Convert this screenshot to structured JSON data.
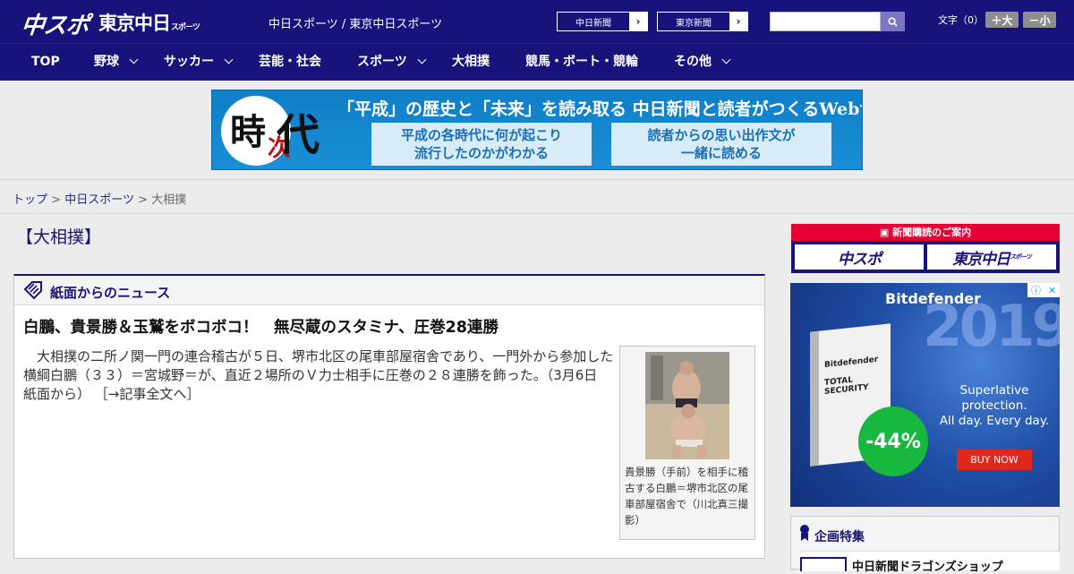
{
  "header": {
    "logo_chuspo": "中スポ",
    "logo_tokyo": "東京中日",
    "logo_tokyo_small": "スポーツ",
    "site_names": "中日スポーツ / 東京中日スポーツ",
    "paper_buttons": [
      {
        "label": "中日新聞",
        "arrow": "›"
      },
      {
        "label": "東京新聞",
        "arrow": "›"
      }
    ],
    "search": {
      "placeholder": "",
      "value": ""
    },
    "font_size": {
      "label": "文字（0）",
      "larger": "＋大",
      "smaller": "－小"
    }
  },
  "nav": [
    {
      "label": "TOP",
      "dropdown": false
    },
    {
      "label": "野球",
      "dropdown": true
    },
    {
      "label": "サッカー",
      "dropdown": true
    },
    {
      "label": "芸能・社会",
      "dropdown": false
    },
    {
      "label": "スポーツ",
      "dropdown": true
    },
    {
      "label": "大相撲",
      "dropdown": false
    },
    {
      "label": "競馬・ボート・競輪",
      "dropdown": false
    },
    {
      "label": "その他",
      "dropdown": true
    }
  ],
  "banner": {
    "logo_ji": "時",
    "logo_tsugi": "次",
    "logo_dai": "代",
    "headline": "「平成」の歴史と「未来」を読み取る 中日新聞と読者がつくるWebサイト",
    "sub_left": [
      "平成の各時代に何が起こり",
      "流行したのかがわかる"
    ],
    "sub_right": [
      "読者からの思い出作文が",
      "一緒に読める"
    ]
  },
  "breadcrumb": {
    "items": [
      {
        "label": "トップ",
        "link": true
      },
      {
        "label": "中日スポーツ",
        "link": true
      },
      {
        "label": "大相撲",
        "link": false
      }
    ],
    "separator": ">"
  },
  "main": {
    "page_title": "【大相撲】",
    "section_title": "紙面からのニュース",
    "article": {
      "title": "白鵬、貴景勝＆玉鷲をボコボコ！　無尽蔵のスタミナ、圧巻28連勝",
      "body": "　大相撲の二所ノ関一門の連合稽古が５日、堺市北区の尾車部屋宿舎であり、一門外から参加した横綱白鵬（３３）＝宮城野＝が、直近２場所のＶ力士相手に圧巻の２８連勝を飾った。（3月6日 紙面から）",
      "read_more": "［→記事全文へ］",
      "caption": "貴景勝（手前）を相手に稽古する白鵬＝堺市北区の尾車部屋宿舎で（川北真三撮影）"
    }
  },
  "sidebar": {
    "subscribe": {
      "strip": "新聞購読のご案内",
      "buttons": [
        "中スポ",
        "東京中日"
      ],
      "button_small": "スポーツ"
    },
    "ad": {
      "brand": "Bitdefender",
      "year": "2019",
      "product_brand": "Bitdefender",
      "product_name": "TOTAL SECURITY",
      "discount": "-44%",
      "copy": [
        "Superlative",
        "protection.",
        "All day. Every day."
      ],
      "cta": "BUY NOW"
    },
    "feature": {
      "title": "企画特集",
      "item": "中日新聞ドラゴンズショップ"
    }
  },
  "colors": {
    "brand_navy": "#17137a",
    "subscribe_red": "#e60033",
    "ad_green": "#18b83f",
    "ad_buy_red": "#e1261c"
  }
}
